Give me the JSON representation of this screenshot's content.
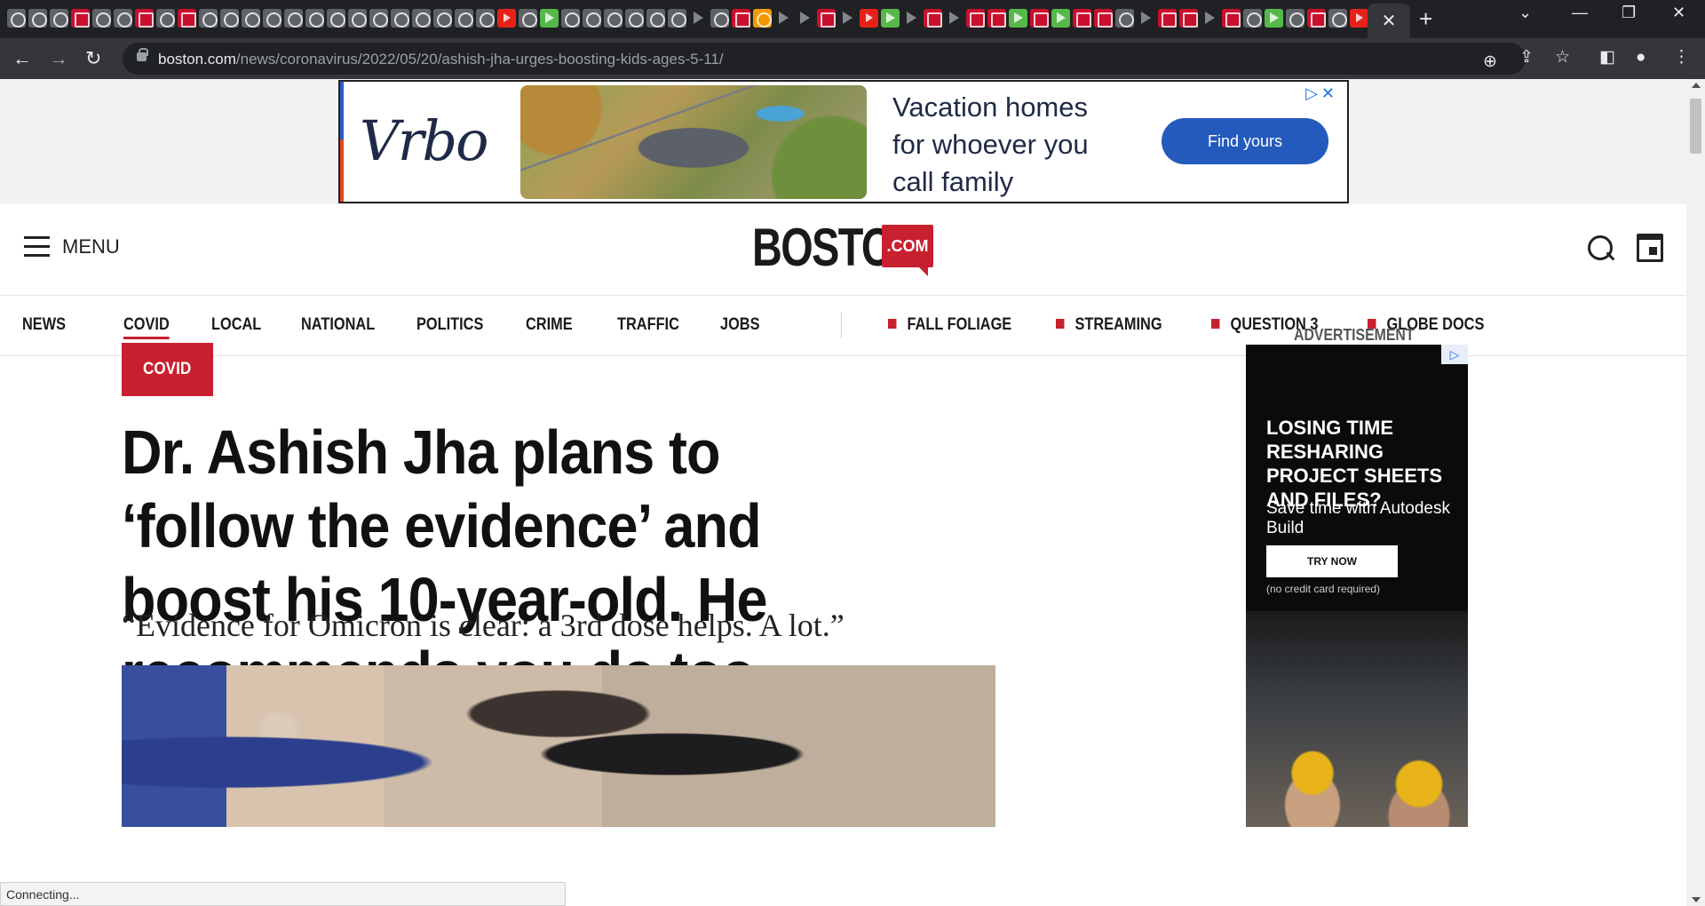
{
  "browser": {
    "tab_icons": [
      "grey",
      "grey",
      "grey",
      "red",
      "grey",
      "grey",
      "red",
      "grey",
      "red",
      "grey",
      "grey",
      "grey",
      "grey",
      "grey",
      "grey",
      "grey",
      "grey",
      "grey",
      "grey",
      "grey",
      "grey",
      "grey",
      "grey",
      "yt",
      "grey",
      "green",
      "grey",
      "grey",
      "grey",
      "grey",
      "grey",
      "grey",
      "play",
      "grey",
      "red",
      "orange",
      "play",
      "play",
      "red",
      "play",
      "yt",
      "green",
      "play",
      "red",
      "play",
      "red",
      "red",
      "green",
      "red",
      "green",
      "red",
      "red",
      "grey",
      "play",
      "red",
      "red",
      "play",
      "red",
      "grey",
      "green",
      "grey",
      "red",
      "grey",
      "yt",
      "blue",
      "yt",
      "yt",
      "grey",
      "blue",
      "red",
      "blue"
    ],
    "active_tab_close": "✕",
    "new_tab": "+",
    "url_domain": "boston.com",
    "url_path": "/news/coronavirus/2022/05/20/ashish-jha-urges-boosting-kids-ages-5-11/",
    "status_text": "Connecting..."
  },
  "top_ad": {
    "brand": "Vrbo",
    "headline": "Vacation homes for whoever you call family",
    "cta": "Find yours",
    "choices": "▷✕"
  },
  "header": {
    "menu_label": "MENU",
    "logo_word": "BOSTON",
    "logo_com": ".COM"
  },
  "nav": {
    "items": [
      "NEWS",
      "COVID",
      "LOCAL",
      "NATIONAL",
      "POLITICS",
      "CRIME",
      "TRAFFIC",
      "JOBS"
    ],
    "active": "COVID",
    "featured": [
      "FALL FOLIAGE",
      "STREAMING",
      "QUESTION 3",
      "GLOBE DOCS"
    ]
  },
  "article": {
    "section_badge": "COVID",
    "headline": "Dr. Ashish Jha plans to ‘follow the evidence’ and boost his 10-year-old. He recommends you do too.",
    "dek": "“Evidence for Omicron is clear: a 3rd dose helps. A lot.”"
  },
  "side_ad": {
    "label": "ADVERTISEMENT",
    "choice": "▷",
    "headline": "LOSING TIME RESHARING PROJECT SHEETS AND FILES?",
    "sub": "Save time with Autodesk Build",
    "cta": "TRY NOW",
    "note": "(no credit card required)"
  }
}
